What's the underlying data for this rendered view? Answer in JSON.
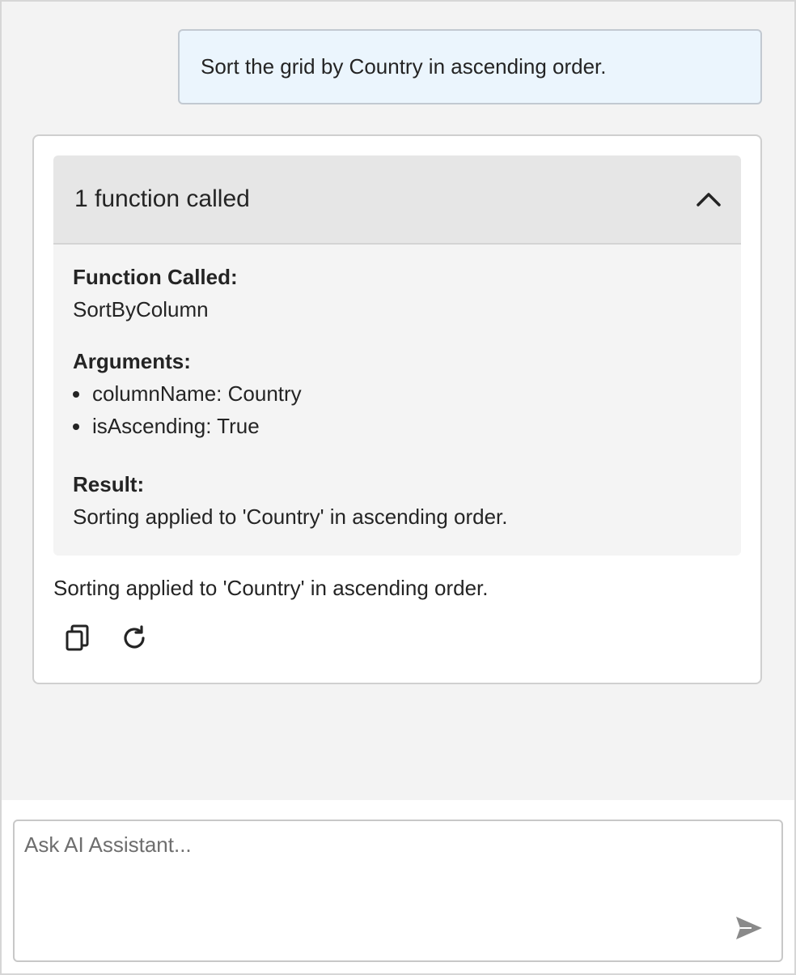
{
  "user_message": "Sort the grid by Country in ascending order.",
  "function_panel": {
    "header": "1 function called",
    "function_label": "Function Called:",
    "function_name": "SortByColumn",
    "arguments_label": "Arguments:",
    "arguments": [
      "columnName: Country",
      "isAscending: True"
    ],
    "result_label": "Result:",
    "result_text": "Sorting applied to 'Country' in ascending order."
  },
  "ai_response": "Sorting applied to 'Country' in ascending order.",
  "input": {
    "placeholder": "Ask AI Assistant..."
  },
  "colors": {
    "chat_background": "#f3f3f3",
    "user_bubble": "#ebf5fd",
    "panel_header": "#e6e6e6",
    "send_icon": "#8a8a8a"
  },
  "icons": {
    "collapse": "chevron-up-icon",
    "copy": "copy-icon",
    "regenerate": "refresh-icon",
    "send": "send-icon"
  }
}
